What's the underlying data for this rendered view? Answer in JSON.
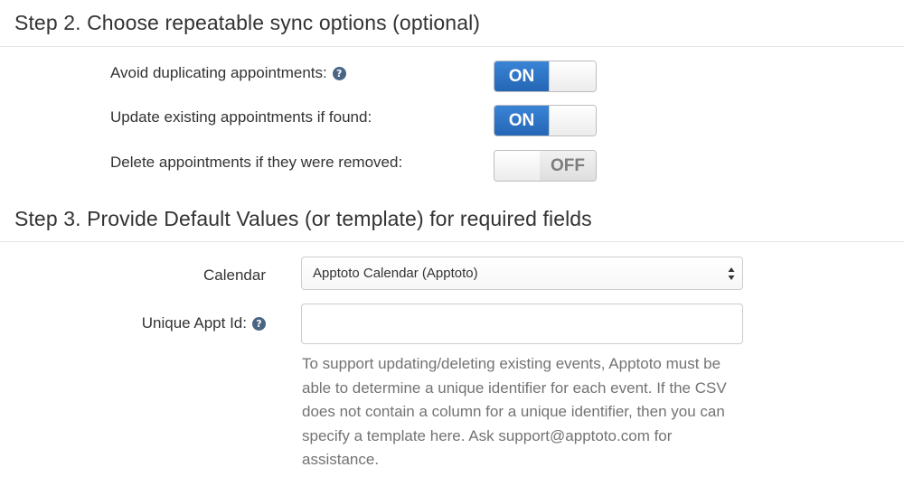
{
  "step2": {
    "heading": "Step 2. Choose repeatable sync options (optional)",
    "options": [
      {
        "label": "Avoid duplicating appointments:",
        "has_help": true,
        "state": "on",
        "toggle_text": "ON"
      },
      {
        "label": "Update existing appointments if found:",
        "has_help": false,
        "state": "on",
        "toggle_text": "ON"
      },
      {
        "label": "Delete appointments if they were removed:",
        "has_help": false,
        "state": "off",
        "toggle_text": "OFF"
      }
    ]
  },
  "step3": {
    "heading": "Step 3. Provide Default Values (or template) for required fields",
    "calendar": {
      "label": "Calendar",
      "selected": "Apptoto Calendar (Apptoto)"
    },
    "unique_appt_id": {
      "label": "Unique Appt Id:",
      "value": "",
      "help_text": "To support updating/deleting existing events, Apptoto must be able to determine a unique identifier for each event. If the CSV does not contain a column for a unique identifier, then you can specify a template here. Ask support@apptoto.com for assistance."
    }
  },
  "icons": {
    "help": "question-circle-icon",
    "select_arrows": "sort-arrows-icon"
  },
  "colors": {
    "toggle_on": "#2f74c5",
    "help_icon": "#4a6584",
    "help_text": "#737373"
  }
}
